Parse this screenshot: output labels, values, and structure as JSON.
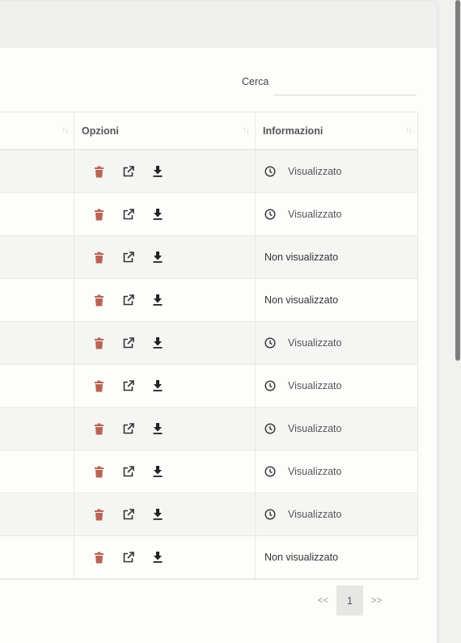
{
  "search": {
    "label": "Cerca",
    "value": ""
  },
  "table": {
    "columns": [
      "",
      "Opzioni",
      "Informazioni"
    ],
    "rows": [
      {
        "viewed": true,
        "info": "Visualizzato"
      },
      {
        "viewed": true,
        "info": "Visualizzato"
      },
      {
        "viewed": false,
        "info": "Non visualizzato"
      },
      {
        "viewed": false,
        "info": "Non visualizzato"
      },
      {
        "viewed": true,
        "info": "Visualizzato"
      },
      {
        "viewed": true,
        "info": "Visualizzato"
      },
      {
        "viewed": true,
        "info": "Visualizzato"
      },
      {
        "viewed": true,
        "info": "Visualizzato"
      },
      {
        "viewed": true,
        "info": "Visualizzato"
      },
      {
        "viewed": false,
        "info": "Non visualizzato"
      }
    ]
  },
  "pagination": {
    "prev": "<<",
    "current": "1",
    "next": ">>"
  },
  "icons": {
    "sort": "sort-icon",
    "delete": "trash-icon",
    "open": "external-link-icon",
    "download": "download-icon",
    "viewed": "clock-icon"
  },
  "colors": {
    "delete_icon": "#b86455",
    "text": "#333333"
  }
}
